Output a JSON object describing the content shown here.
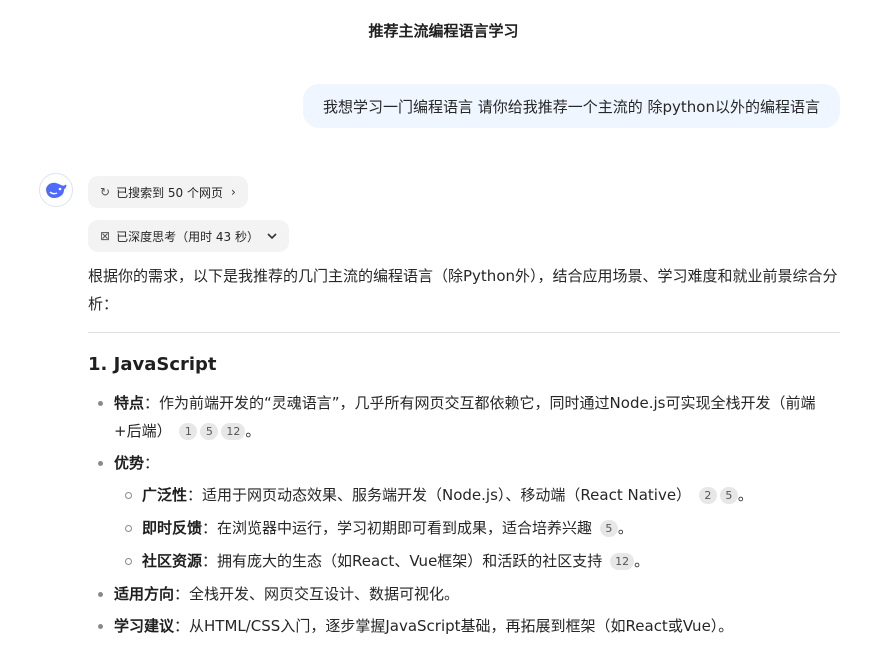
{
  "header": {
    "title": "推荐主流编程语言学习"
  },
  "user_message": "我想学习一门编程语言 请你给我推荐一个主流的 除python以外的编程语言",
  "assistant": {
    "search_pill": {
      "icon": "refresh-search-icon",
      "label": "已搜索到 50 个网页",
      "chevron": "›"
    },
    "think_pill": {
      "icon": "think-icon",
      "label": "已深度思考（用时 43 秒）",
      "chevron": "⌄"
    },
    "intro": "根据你的需求，以下是我推荐的几门主流的编程语言（除Python外），结合应用场景、学习难度和就业前景综合分析：",
    "section1": {
      "heading": "1. JavaScript",
      "features_label": "特点",
      "features_text": "：作为前端开发的“灵魂语言”，几乎所有网页交互都依赖它，同时通过Node.js可实现全栈开发（前端+后端）",
      "features_cites": [
        "1",
        "5",
        "12"
      ],
      "advantages_label": "优势",
      "advantages_colon": "：",
      "sub": [
        {
          "label": "广泛性",
          "text": "：适用于网页动态效果、服务端开发（Node.js）、移动端（React Native）",
          "cites": [
            "2",
            "5"
          ]
        },
        {
          "label": "即时反馈",
          "text": "：在浏览器中运行，学习初期即可看到成果，适合培养兴趣",
          "cites": [
            "5"
          ]
        },
        {
          "label": "社区资源",
          "text": "：拥有庞大的生态（如React、Vue框架）和活跃的社区支持",
          "cites": [
            "12"
          ]
        }
      ],
      "direction_label": "适用方向",
      "direction_text": "：全栈开发、网页交互设计、数据可视化。",
      "advice_label": "学习建议",
      "advice_text": "：从HTML/CSS入门，逐步掌握JavaScript基础，再拓展到框架（如React或Vue）。",
      "period": "。"
    }
  }
}
